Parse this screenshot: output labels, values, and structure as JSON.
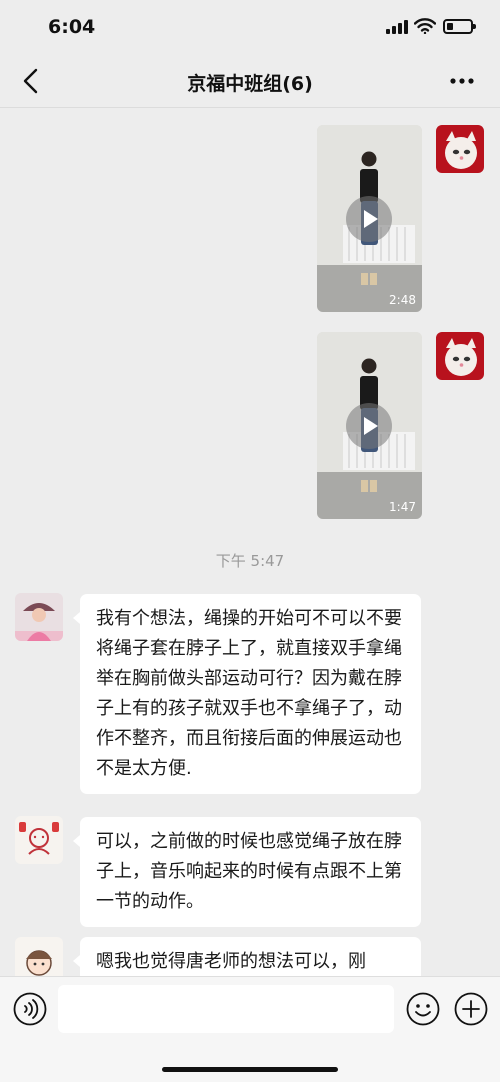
{
  "status_bar": {
    "time": "6:04"
  },
  "nav": {
    "title": "京福中班组(6)"
  },
  "messages": {
    "video_1": {
      "duration": "2:48"
    },
    "video_2": {
      "duration": "1:47"
    },
    "timestamp": "下午 5:47",
    "text_1": "我有个想法，绳操的开始可不可以不要将绳子套在脖子上了，就直接双手拿绳举在胸前做头部运动可行？因为戴在脖子上有的孩子就双手也不拿绳子了，动作不整齐，而且衔接后面的伸展运动也不是太方便.",
    "text_2": "可以，之前做的时候也感觉绳子放在脖子上，音乐响起来的时候有点跟不上第一节的动作。",
    "text_3": "嗯我也觉得唐老师的想法可以，刚"
  },
  "input_bar": {
    "message_value": ""
  },
  "colors": {
    "background": "#ededed",
    "bubble": "#ffffff",
    "timestamp": "#999999"
  },
  "icons": [
    "back-arrow-icon",
    "more-dots-icon",
    "play-icon",
    "voice-icon",
    "emoji-icon",
    "add-icon",
    "signal-icon",
    "wifi-icon",
    "battery-icon"
  ]
}
